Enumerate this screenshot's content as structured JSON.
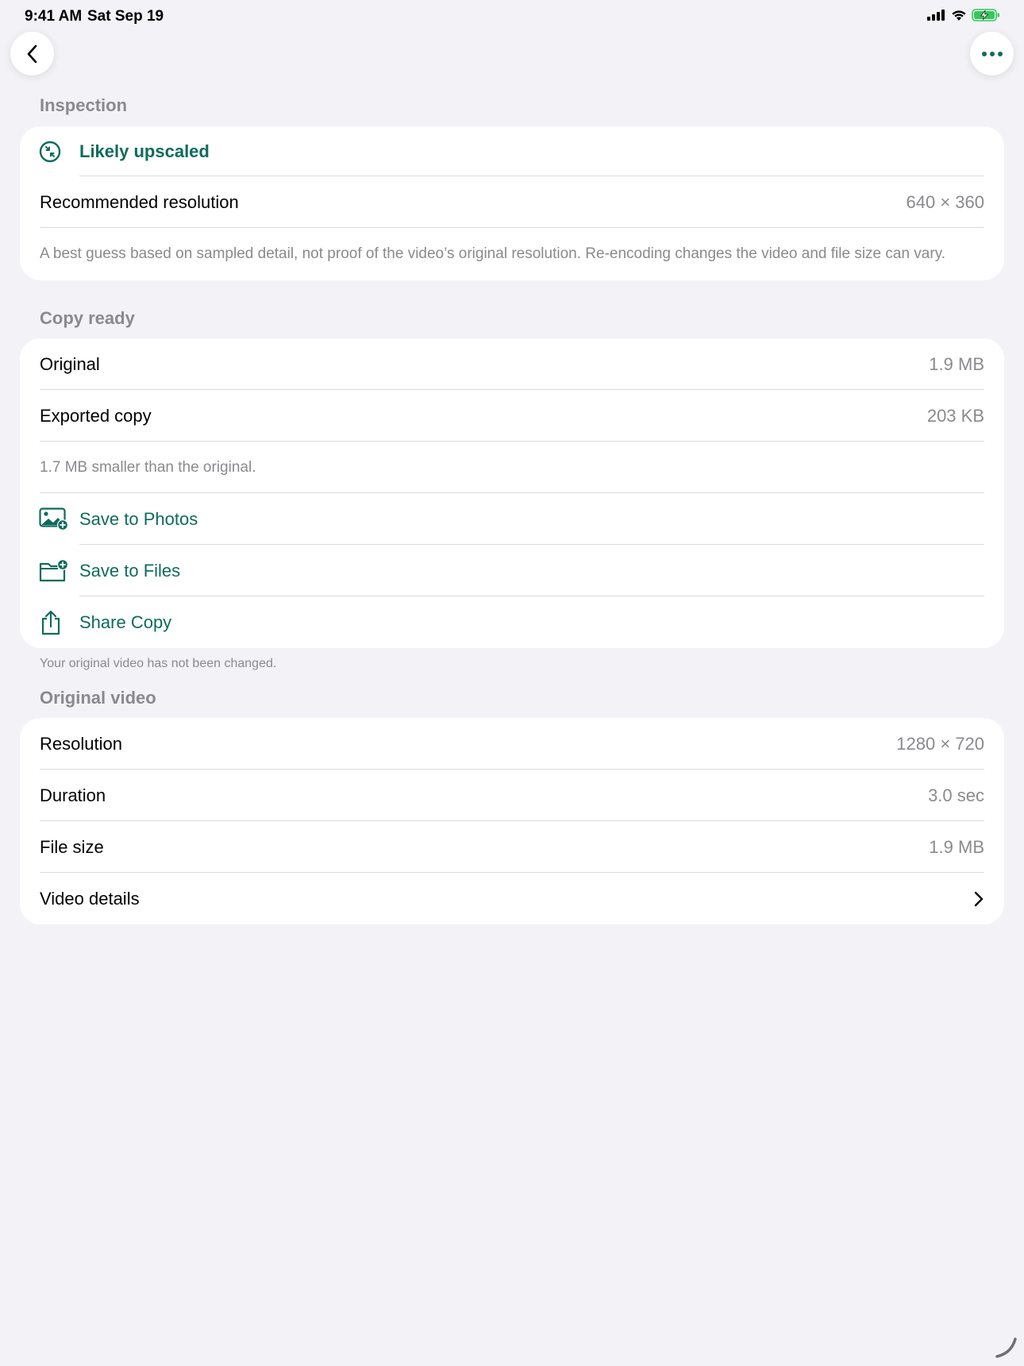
{
  "status_bar": {
    "time": "9:41 AM",
    "date": "Sat Sep 19"
  },
  "nav": {
    "back_icon": "chevron-left-icon",
    "more_icon": "ellipsis-icon"
  },
  "inspection": {
    "header": "Inspection",
    "verdict": "Likely upscaled",
    "recommended_label": "Recommended resolution",
    "recommended_value": "640 × 360",
    "note": "A best guess based on sampled detail, not proof of the video’s original resolution. Re-encoding changes the video and file size can vary."
  },
  "copy_ready": {
    "header": "Copy ready",
    "original_label": "Original",
    "original_value": "1.9 MB",
    "exported_label": "Exported copy",
    "exported_value": "203 KB",
    "savings_note": "1.7 MB smaller than the original.",
    "actions": [
      {
        "label": "Save to Photos",
        "icon": "photo-add-icon"
      },
      {
        "label": "Save to Files",
        "icon": "folder-add-icon"
      },
      {
        "label": "Share Copy",
        "icon": "share-icon"
      }
    ],
    "footnote": "Your original video has not been changed."
  },
  "original_video": {
    "header": "Original video",
    "resolution_label": "Resolution",
    "resolution_value": "1280 × 720",
    "duration_label": "Duration",
    "duration_value": "3.0 sec",
    "filesize_label": "File size",
    "filesize_value": "1.9 MB",
    "details_label": "Video details"
  },
  "colors": {
    "accent": "#0f6b5c",
    "background": "#f2f2f7",
    "secondary_text": "#8a8a8e"
  }
}
